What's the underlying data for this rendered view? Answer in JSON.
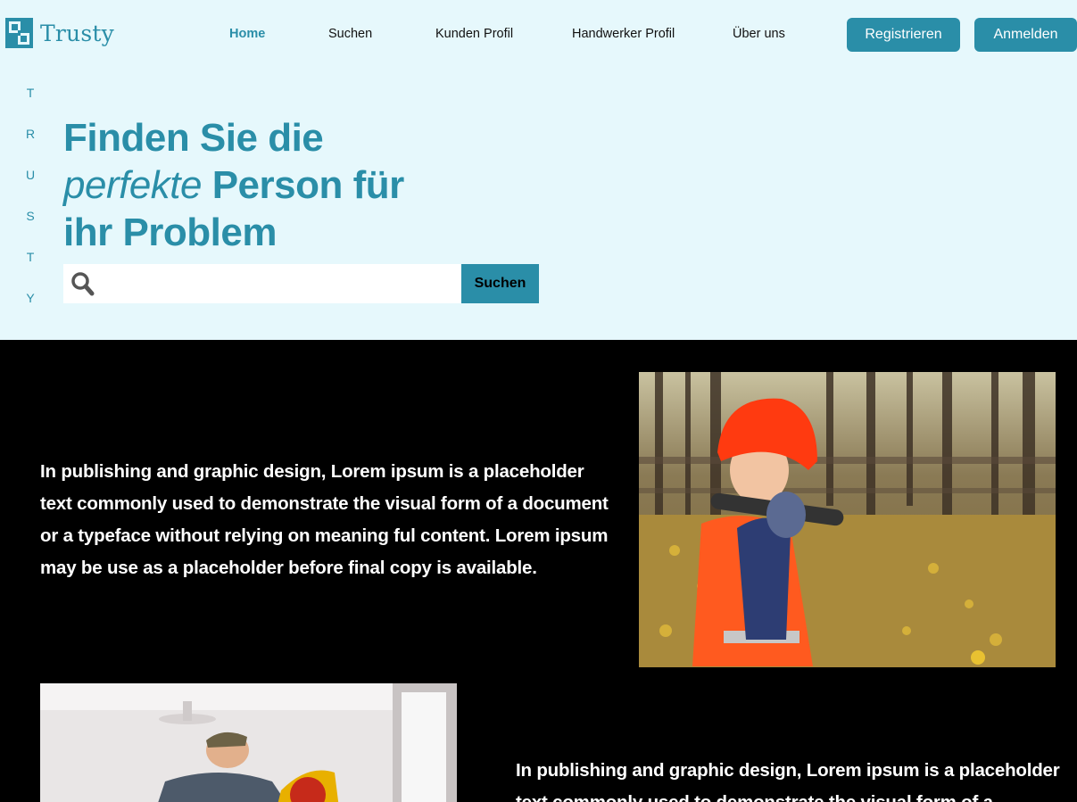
{
  "brand": {
    "name": "Trusty",
    "color": "#2a8ea8"
  },
  "nav": {
    "items": [
      {
        "label": "Home",
        "active": true
      },
      {
        "label": "Suchen"
      },
      {
        "label": "Kunden Profil"
      },
      {
        "label": "Handwerker Profil"
      },
      {
        "label": "Über uns"
      }
    ]
  },
  "header": {
    "register_label": "Registrieren",
    "login_label": "Anmelden"
  },
  "side_letters": [
    "T",
    "R",
    "U",
    "S",
    "T",
    "Y"
  ],
  "hero": {
    "line1": "Finden Sie die",
    "emphasis": "perfekte",
    "line2_rest": " Person für",
    "line3": "ihr Problem",
    "search_placeholder": "",
    "search_button": "Suchen"
  },
  "sections": [
    {
      "text": "In publishing and graphic design, Lorem ipsum is a placeholder text commonly used to demonstrate the visual form of a document or a typeface without relying on meaning ful content. Lorem ipsum may be use as a placeholder before final copy is available.",
      "image_alt": "child-with-hardhat-and-wrench-photo"
    },
    {
      "text": "In publishing and graphic design, Lorem ipsum is a placeholder text commonly used to demonstrate the visual form of a",
      "image_alt": "craftsman-with-saw-photo"
    }
  ],
  "colors": {
    "accent": "#2a8ea8",
    "hero_bg": "#e6f8fc",
    "content_bg": "#000000"
  }
}
